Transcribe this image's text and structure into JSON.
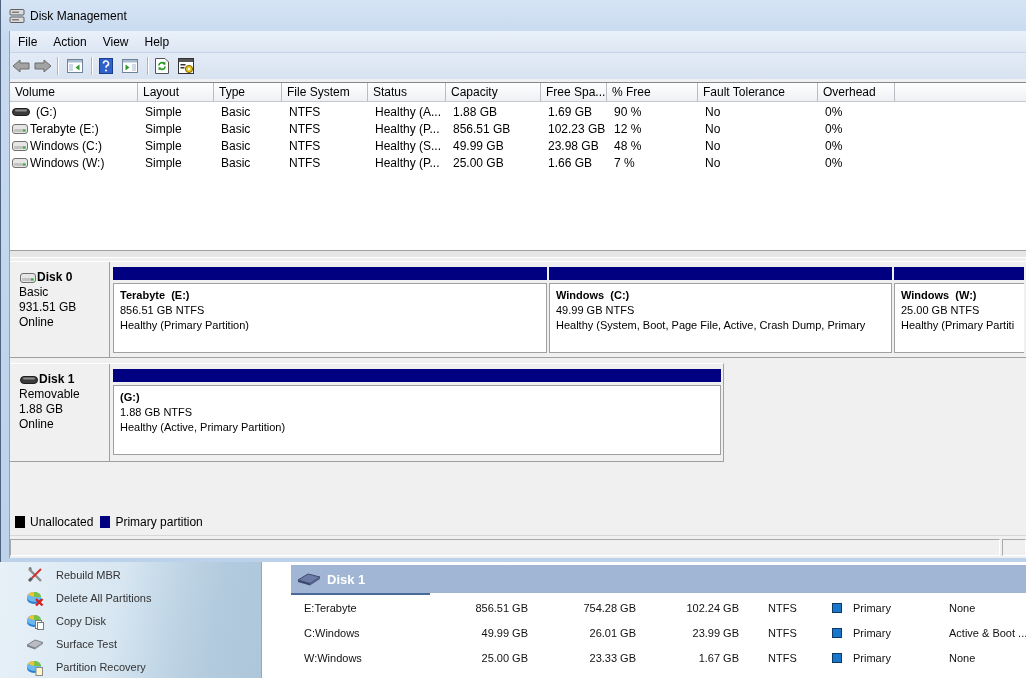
{
  "window": {
    "title": "Disk Management"
  },
  "menu": [
    {
      "label": "File"
    },
    {
      "label": "Action"
    },
    {
      "label": "View"
    },
    {
      "label": "Help"
    }
  ],
  "volume_table": {
    "columns": [
      "Volume",
      "Layout",
      "Type",
      "File System",
      "Status",
      "Capacity",
      "Free Spa...",
      "% Free",
      "Fault Tolerance",
      "Overhead"
    ],
    "rows": [
      {
        "kind": "removable",
        "cells": [
          "(G:)",
          "Simple",
          "Basic",
          "NTFS",
          "Healthy (A...",
          "1.88 GB",
          "1.69 GB",
          "90 %",
          "No",
          "0%"
        ]
      },
      {
        "kind": "fixed",
        "cells": [
          "Terabyte (E:)",
          "Simple",
          "Basic",
          "NTFS",
          "Healthy (P...",
          "856.51 GB",
          "102.23 GB",
          "12 %",
          "No",
          "0%"
        ]
      },
      {
        "kind": "fixed",
        "cells": [
          "Windows (C:)",
          "Simple",
          "Basic",
          "NTFS",
          "Healthy (S...",
          "49.99 GB",
          "23.98 GB",
          "48 %",
          "No",
          "0%"
        ]
      },
      {
        "kind": "fixed",
        "cells": [
          "Windows (W:)",
          "Simple",
          "Basic",
          "NTFS",
          "Healthy (P...",
          "25.00 GB",
          "1.66 GB",
          "7 %",
          "No",
          "0%"
        ]
      }
    ]
  },
  "disks": [
    {
      "name": "Disk 0",
      "kind": "fixed",
      "details": [
        "Basic",
        "931.51 GB",
        "Online"
      ],
      "partitions": [
        {
          "name": "Terabyte  (E:)",
          "size": "856.51 GB NTFS",
          "status": "Healthy (Primary Partition)"
        },
        {
          "name": "Windows  (C:)",
          "size": "49.99 GB NTFS",
          "status": "Healthy (System, Boot, Page File, Active, Crash Dump, Primary"
        },
        {
          "name": "Windows  (W:)",
          "size": "25.00 GB NTFS",
          "status": "Healthy (Primary Partiti"
        }
      ]
    },
    {
      "name": "Disk 1",
      "kind": "removable",
      "details": [
        "Removable",
        "1.88 GB",
        "Online"
      ],
      "partitions": [
        {
          "name": "(G:)",
          "size": "1.88 GB NTFS",
          "status": "Healthy (Active, Primary Partition)"
        }
      ]
    }
  ],
  "legend": [
    {
      "label": "Unallocated",
      "color": "#000000"
    },
    {
      "label": "Primary partition",
      "color": "#000080"
    }
  ],
  "tool_panel": {
    "items": [
      {
        "label": "Rebuild MBR"
      },
      {
        "label": "Delete All Partitions"
      },
      {
        "label": "Copy Disk"
      },
      {
        "label": "Surface Test"
      },
      {
        "label": "Partition Recovery"
      }
    ]
  },
  "disk_panel": {
    "title": "Disk 1",
    "rows": [
      {
        "cells": [
          "E:Terabyte",
          "856.51 GB",
          "754.28 GB",
          "102.24 GB",
          "NTFS",
          "Primary",
          "None"
        ]
      },
      {
        "cells": [
          "C:Windows",
          "49.99 GB",
          "26.01 GB",
          "23.99 GB",
          "NTFS",
          "Primary",
          "Active & Boot ..."
        ]
      },
      {
        "cells": [
          "W:Windows",
          "25.00 GB",
          "23.33 GB",
          "1.67 GB",
          "NTFS",
          "Primary",
          "None"
        ]
      }
    ]
  }
}
